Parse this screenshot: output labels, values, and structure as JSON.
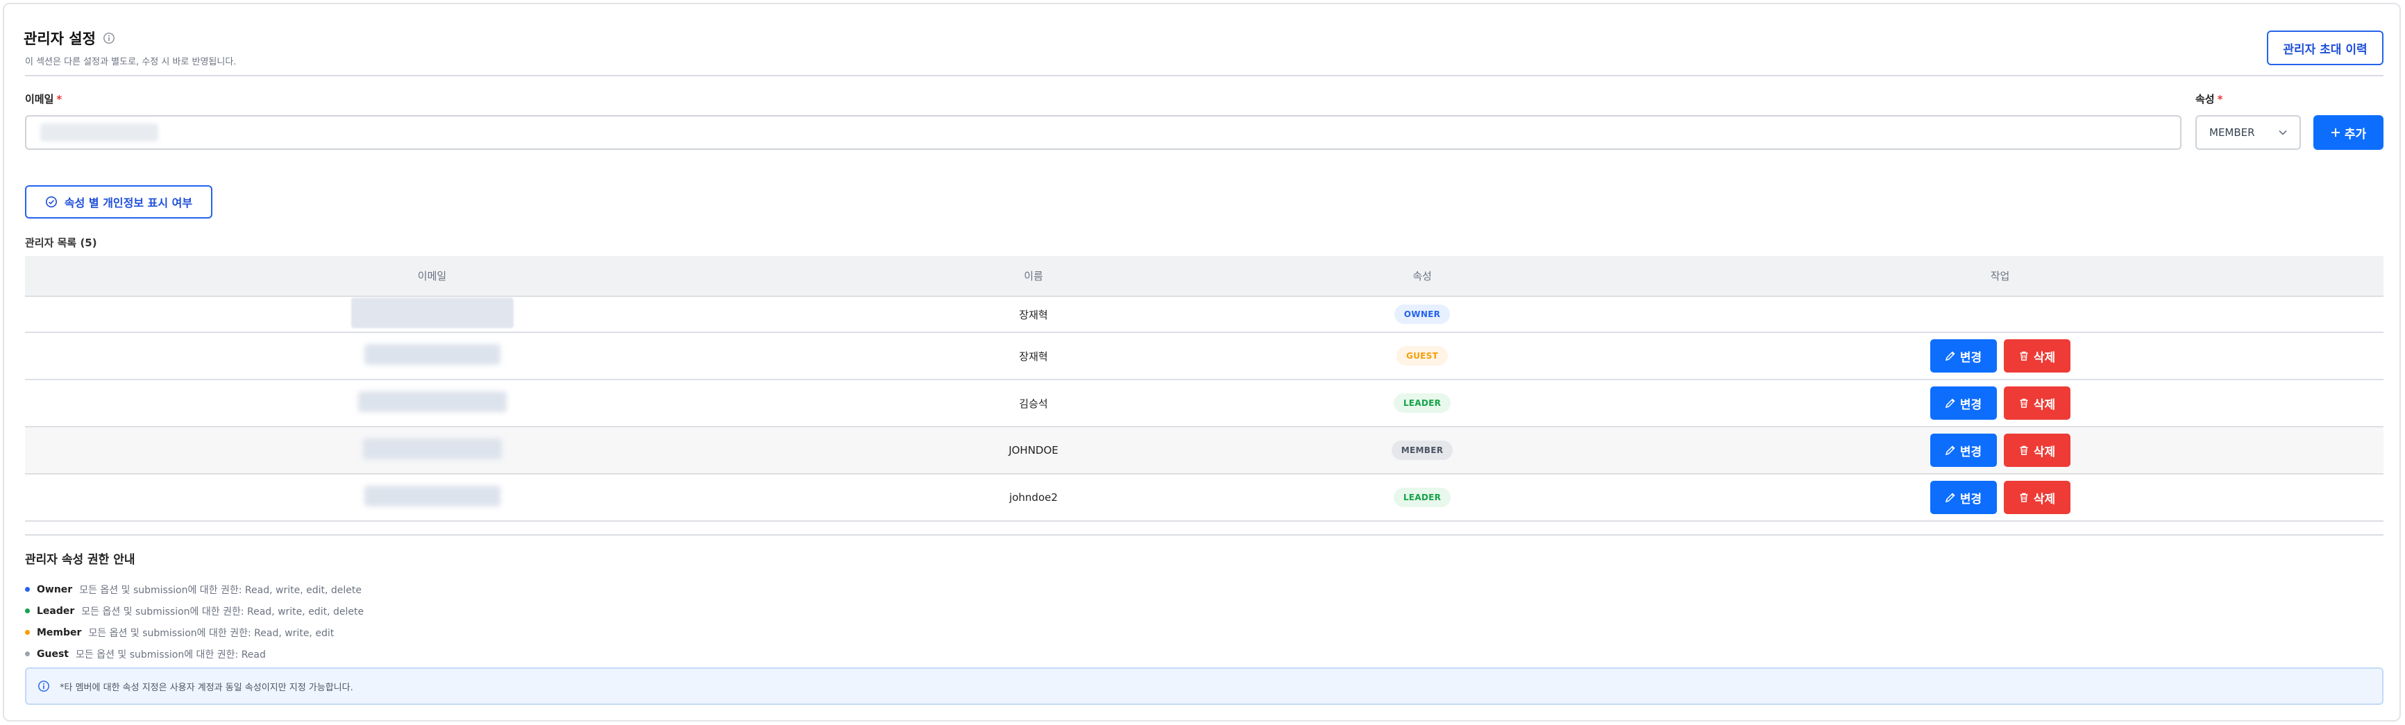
{
  "header": {
    "title": "관리자 설정",
    "subtitle": "이 섹션은 다른 설정과 별도로, 수정 시 바로 반영됩니다.",
    "history_button": "관리자 초대 이력"
  },
  "form": {
    "email_label": "이메일",
    "attribute_label": "속성",
    "required_mark": "*",
    "attribute_selected": "MEMBER",
    "add_button": "추가"
  },
  "privacy_button": "속성 별 개인정보 표시 여부",
  "list_title": "관리자 목록 (5)",
  "table": {
    "columns": [
      "이메일",
      "이름",
      "속성",
      "작업"
    ],
    "edit_label": "변경",
    "delete_label": "삭제",
    "rows": [
      {
        "name": "장재혁",
        "role": "OWNER",
        "role_bg": "#e7f0ff",
        "role_fg": "#2563eb"
      },
      {
        "name": "장재혁",
        "role": "GUEST",
        "role_bg": "#fff4e5",
        "role_fg": "#f59e0b"
      },
      {
        "name": "김승석",
        "role": "LEADER",
        "role_bg": "#e8f8ec",
        "role_fg": "#16a34a"
      },
      {
        "name": "JOHNDOE",
        "role": "MEMBER",
        "role_bg": "#e5e7eb",
        "role_fg": "#4b5563"
      },
      {
        "name": "johndoe2",
        "role": "LEADER",
        "role_bg": "#e8f8ec",
        "role_fg": "#16a34a"
      }
    ]
  },
  "guide": {
    "title": "관리자 속성 권한 안내",
    "items": [
      {
        "role": "Owner",
        "desc": "모든 옵션 및 submission에 대한 권한: Read, write, edit, delete",
        "color": "#2563eb"
      },
      {
        "role": "Leader",
        "desc": "모든 옵션 및 submission에 대한 권한: Read, write, edit, delete",
        "color": "#16a34a"
      },
      {
        "role": "Member",
        "desc": "모든 옵션 및 submission에 대한 권한: Read, write, edit",
        "color": "#f59e0b"
      },
      {
        "role": "Guest",
        "desc": "모든 옵션 및 submission에 대한 권한: Read",
        "color": "#9ca3af"
      }
    ]
  },
  "notice": "*타 멤버에 대한 속성 지정은 사용자 계정과 동일 속성이지만 지정 가능합니다."
}
